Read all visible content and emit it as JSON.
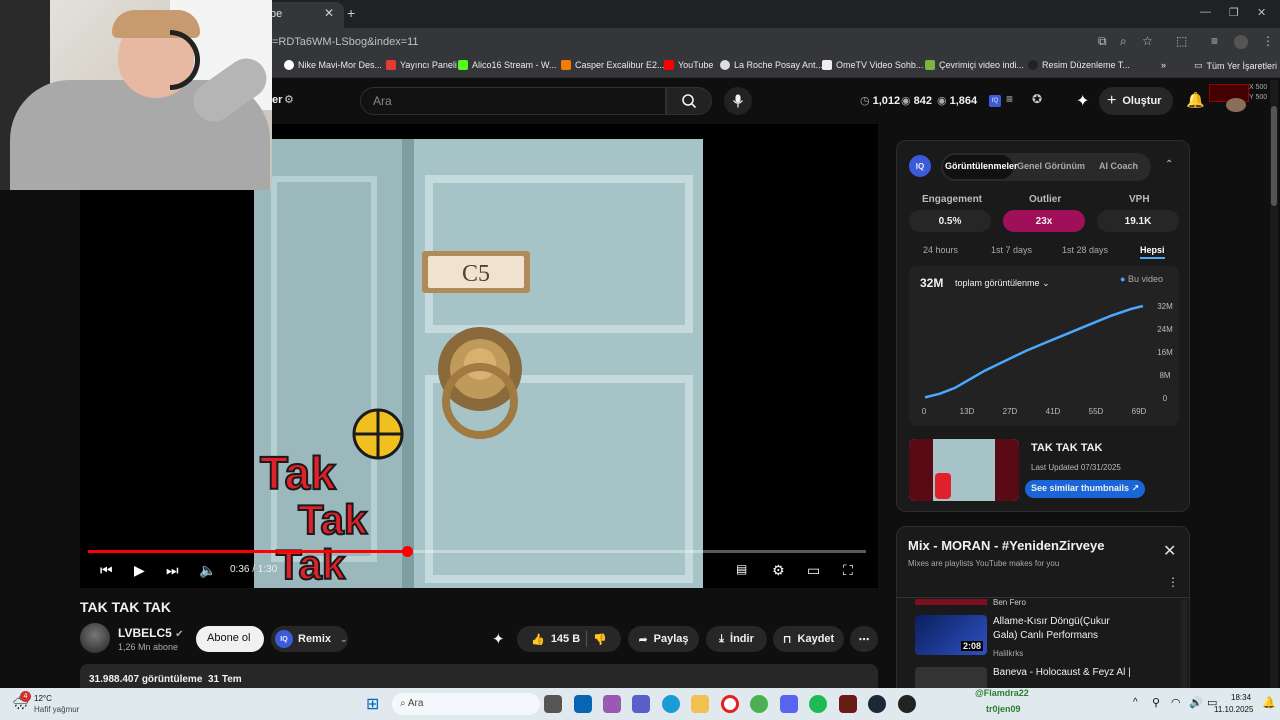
{
  "browser": {
    "tab_title": "be",
    "url": "=RDTa6WM-LSbog&index=11",
    "bookmarks": [
      "Nike Mavi-Mor Des...",
      "Yayıncı Paneli",
      "Alico16 Stream - W...",
      "Casper Excalibur E2...",
      "YouTube",
      "La Roche Posay Ant...",
      "OmeTV Video Sohb...",
      "Çevrimiçi video indi...",
      "Resim Düzenleme T..."
    ],
    "all_bookmarks_label": "Tüm Yer İşaretleri",
    "overlay_x": "X 500",
    "overlay_y": "Y 500"
  },
  "header": {
    "filter_label": "er",
    "search_placeholder": "Ara",
    "stat_1": "1,012",
    "stat_2": "842",
    "stat_3": "1,864",
    "create_label": "Oluştur"
  },
  "player": {
    "time": "0:36 / 1:30",
    "progress": 0.41,
    "plate_text": "C5",
    "overlay_text": [
      "Tak",
      "Tak",
      "Tak"
    ]
  },
  "video": {
    "title": "TAK TAK TAK",
    "channel": "LVBELC5",
    "subscribers": "1,26 Mn abone",
    "subscribe_label": "Abone ol",
    "remix_label": "Remix",
    "like_count": "145 B",
    "share_label": "Paylaş",
    "download_label": "İndir",
    "save_label": "Kaydet",
    "views_date": "31.988.407 görüntüleme  31 Tem"
  },
  "iq": {
    "logo": "IQ",
    "tabs": [
      "Görüntülenmeler",
      "Genel Görünüm",
      "AI Coach"
    ],
    "metrics": [
      {
        "label": "Engagement",
        "value": "0.5%"
      },
      {
        "label": "Outlier",
        "value": "23x"
      },
      {
        "label": "VPH",
        "value": "19.1K"
      }
    ],
    "ranges": [
      "24 hours",
      "1st 7 days",
      "1st 28 days",
      "Hepsi"
    ],
    "total": "32M",
    "metric_select": "toplam görüntülenme",
    "legend": "Bu video",
    "thumb_title": "TAK TAK TAK",
    "last_updated": "Last Updated 07/31/2025",
    "similar_btn": "See similar thumbnails"
  },
  "chart_data": {
    "type": "line",
    "x": [
      0,
      5,
      10,
      15,
      20,
      27,
      34,
      41,
      48,
      55,
      62,
      69,
      73
    ],
    "y": [
      0.2,
      1.5,
      3.5,
      6.5,
      9.5,
      13,
      16.5,
      19.5,
      22.5,
      25.5,
      28.5,
      31,
      32
    ],
    "x_ticks": [
      "0",
      "13D",
      "27D",
      "41D",
      "55D",
      "69D"
    ],
    "y_ticks": [
      "32M",
      "24M",
      "16M",
      "8M",
      "0"
    ],
    "xlim": [
      0,
      73
    ],
    "ylim": [
      0,
      32
    ],
    "units": "M",
    "series_color": "#4aa8ff"
  },
  "mix": {
    "title": "Mix - MORAN - #YenidenZirveye",
    "subtitle": "Mixes are playlists YouTube makes for you",
    "items": [
      {
        "title": "",
        "channel": "Ben Fero",
        "duration": ""
      },
      {
        "title": "Allame-Kısır Döngü(Çukur Gala) Canlı Performans",
        "channel": "Halilkrks",
        "duration": "2:08"
      },
      {
        "title": "Baneva - Holocaust & Feyz Al |",
        "channel": "",
        "duration": ""
      }
    ]
  },
  "taskbar": {
    "weather_temp": "12°C",
    "weather_desc": "Hafif yağmur",
    "search_placeholder": "Ara",
    "time": "18:34",
    "date": "11.10.2025",
    "notif_count": "4",
    "overlay_name_1": "@Flamdra22",
    "overlay_name_2": "tr0jen09"
  }
}
